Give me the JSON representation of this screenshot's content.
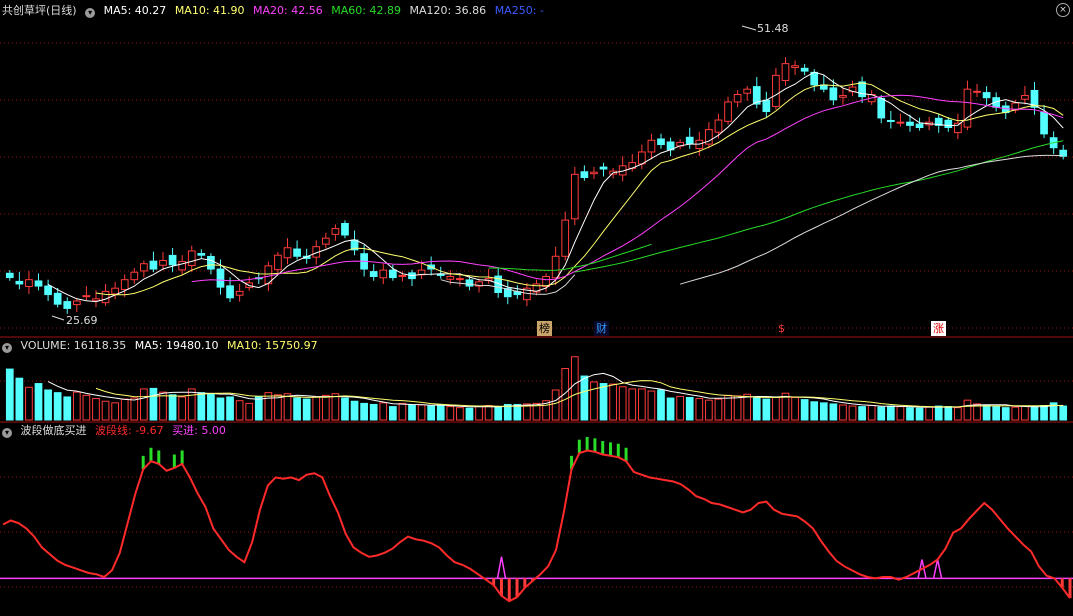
{
  "title": "共创草坪(日线)",
  "colors": {
    "up": "#ff3b3b",
    "down": "#54ffff",
    "ma5": "#ffffff",
    "ma10": "#ffff6e",
    "ma20": "#ff40ff",
    "ma60": "#28dc28",
    "ma120": "#dcdcdc",
    "ma250": "#3c5aff",
    "wave": "#ff2a2a",
    "buy": "#ff40ff",
    "grid": "#8c1010"
  },
  "price_panel": {
    "indicators": [
      {
        "label": "MA5: 40.27",
        "color": "#ffffff"
      },
      {
        "label": "MA10: 41.90",
        "color": "#ffff6e"
      },
      {
        "label": "MA20: 42.56",
        "color": "#ff40ff"
      },
      {
        "label": "MA60: 42.89",
        "color": "#28dc28"
      },
      {
        "label": "MA120: 36.86",
        "color": "#dcdcdc"
      },
      {
        "label": "MA250: -",
        "color": "#3c5aff"
      }
    ],
    "high_label": "51.48",
    "low_label": "25.69",
    "markers": [
      "榜",
      "财",
      "$",
      "涨"
    ]
  },
  "volume_panel": {
    "name": "VOLUME",
    "value": "16118.35",
    "ma5": "MA5: 19480.10",
    "ma10": "MA10: 15750.97"
  },
  "wave_panel": {
    "name": "波段做底买进",
    "line_label": "波段线: -9.67",
    "buy_label": "买进: 5.00"
  },
  "chart_data": [
    {
      "type": "candlestick",
      "title": "共创草坪(日线)",
      "closes": [
        28.8,
        28.2,
        28.6,
        28.0,
        27.2,
        26.3,
        25.9,
        26.6,
        27.1,
        26.8,
        27.5,
        27.8,
        28.6,
        29.3,
        30.1,
        29.6,
        30.4,
        30.0,
        30.3,
        31.3,
        30.9,
        29.6,
        27.9,
        26.9,
        27.5,
        28.3,
        28.7,
        29.9,
        30.9,
        31.6,
        30.8,
        30.6,
        31.7,
        32.5,
        33.4,
        32.8,
        31.4,
        29.6,
        28.9,
        29.5,
        28.8,
        29.0,
        28.7,
        29.5,
        29.6,
        29.0,
        28.9,
        28.7,
        28.0,
        28.4,
        28.7,
        27.4,
        27.0,
        27.2,
        27.8,
        28.2,
        28.9,
        30.8,
        34.2,
        38.5,
        38.2,
        38.7,
        39.0,
        38.8,
        39.3,
        39.6,
        40.6,
        41.7,
        41.3,
        40.8,
        41.5,
        41.4,
        41.7,
        42.7,
        43.6,
        45.3,
        46.0,
        46.5,
        45.1,
        44.4,
        47.8,
        48.9,
        48.7,
        48.2,
        46.9,
        46.5,
        45.5,
        45.9,
        46.7,
        45.8,
        46.0,
        43.8,
        43.5,
        43.4,
        43.1,
        42.9,
        43.4,
        43.1,
        42.9,
        43.3,
        46.5,
        46.3,
        45.7,
        44.8,
        44.3,
        45.2,
        45.9,
        44.8,
        42.3,
        41.0,
        40.2
      ],
      "ma5_last": 40.27,
      "ma10_last": 41.9,
      "ma20_last": 42.56,
      "ma60_last": 42.89,
      "ma120_last": 36.86,
      "high": 51.48,
      "low": 25.69,
      "ylim": [
        25.0,
        53.0
      ]
    },
    {
      "type": "bar",
      "title": "VOLUME",
      "values": [
        9500,
        7800,
        6100,
        6800,
        5600,
        5100,
        4300,
        5200,
        4600,
        4000,
        3500,
        3200,
        3900,
        4100,
        5800,
        5900,
        5200,
        4700,
        4300,
        5800,
        5100,
        4900,
        4100,
        4300,
        3600,
        3100,
        4300,
        5100,
        4700,
        4900,
        4100,
        3900,
        4300,
        4600,
        4900,
        4100,
        3500,
        3100,
        2900,
        3200,
        2500,
        3100,
        2800,
        2800,
        2600,
        2700,
        2500,
        2300,
        2200,
        2600,
        2700,
        2400,
        2900,
        2900,
        3000,
        3100,
        3600,
        5600,
        9600,
        11800,
        8200,
        7100,
        6800,
        6700,
        6200,
        5800,
        5800,
        5400,
        5600,
        4100,
        4400,
        4200,
        4000,
        3700,
        3900,
        4600,
        4500,
        4800,
        4100,
        3900,
        4200,
        5000,
        4200,
        3800,
        3400,
        3200,
        3000,
        2800,
        2600,
        2500,
        2700,
        2400,
        2600,
        2500,
        2300,
        2200,
        2400,
        2600,
        2500,
        2300,
        3700,
        3000,
        2800,
        2500,
        2300,
        2400,
        2600,
        2500,
        2700,
        3200,
        2600
      ],
      "ma5_last": 19480.1,
      "ma10_last": 15750.97,
      "ylim": [
        0,
        12500
      ]
    },
    {
      "type": "line",
      "title": "波段做底买进",
      "series": [
        {
          "name": "波段线",
          "values": [
            45,
            48,
            46,
            42,
            36,
            28,
            23,
            18,
            15,
            13,
            11,
            9,
            8,
            6,
            11,
            24,
            46,
            68,
            86,
            92,
            90,
            85,
            87,
            90,
            80,
            68,
            58,
            42,
            34,
            26,
            21,
            17,
            32,
            56,
            74,
            80,
            79,
            80,
            78,
            82,
            83,
            80,
            66,
            54,
            38,
            28,
            24,
            21,
            22,
            24,
            27,
            32,
            36,
            34,
            33,
            31,
            28,
            22,
            17,
            15,
            12,
            8,
            4,
            0,
            -8,
            -12,
            -9,
            -2,
            3,
            8,
            14,
            26,
            54,
            86,
            98,
            100,
            99,
            97,
            96,
            95,
            92,
            84,
            82,
            80,
            79,
            78,
            77,
            75,
            71,
            66,
            64,
            61,
            60,
            58,
            56,
            54,
            56,
            61,
            62,
            56,
            53,
            52,
            51,
            47,
            42,
            33,
            25,
            18,
            14,
            11,
            8,
            6,
            5,
            6,
            6,
            4,
            6,
            9,
            12,
            15,
            19,
            27,
            39,
            42,
            49,
            55,
            61,
            56,
            49,
            42,
            36,
            30,
            25,
            14,
            7,
            5,
            -2,
            -9.67
          ]
        },
        {
          "name": "买进",
          "values": [
            5
          ]
        }
      ],
      "line_last": -9.67,
      "buy_last": 5.0,
      "ylim": [
        -20,
        110
      ]
    }
  ]
}
